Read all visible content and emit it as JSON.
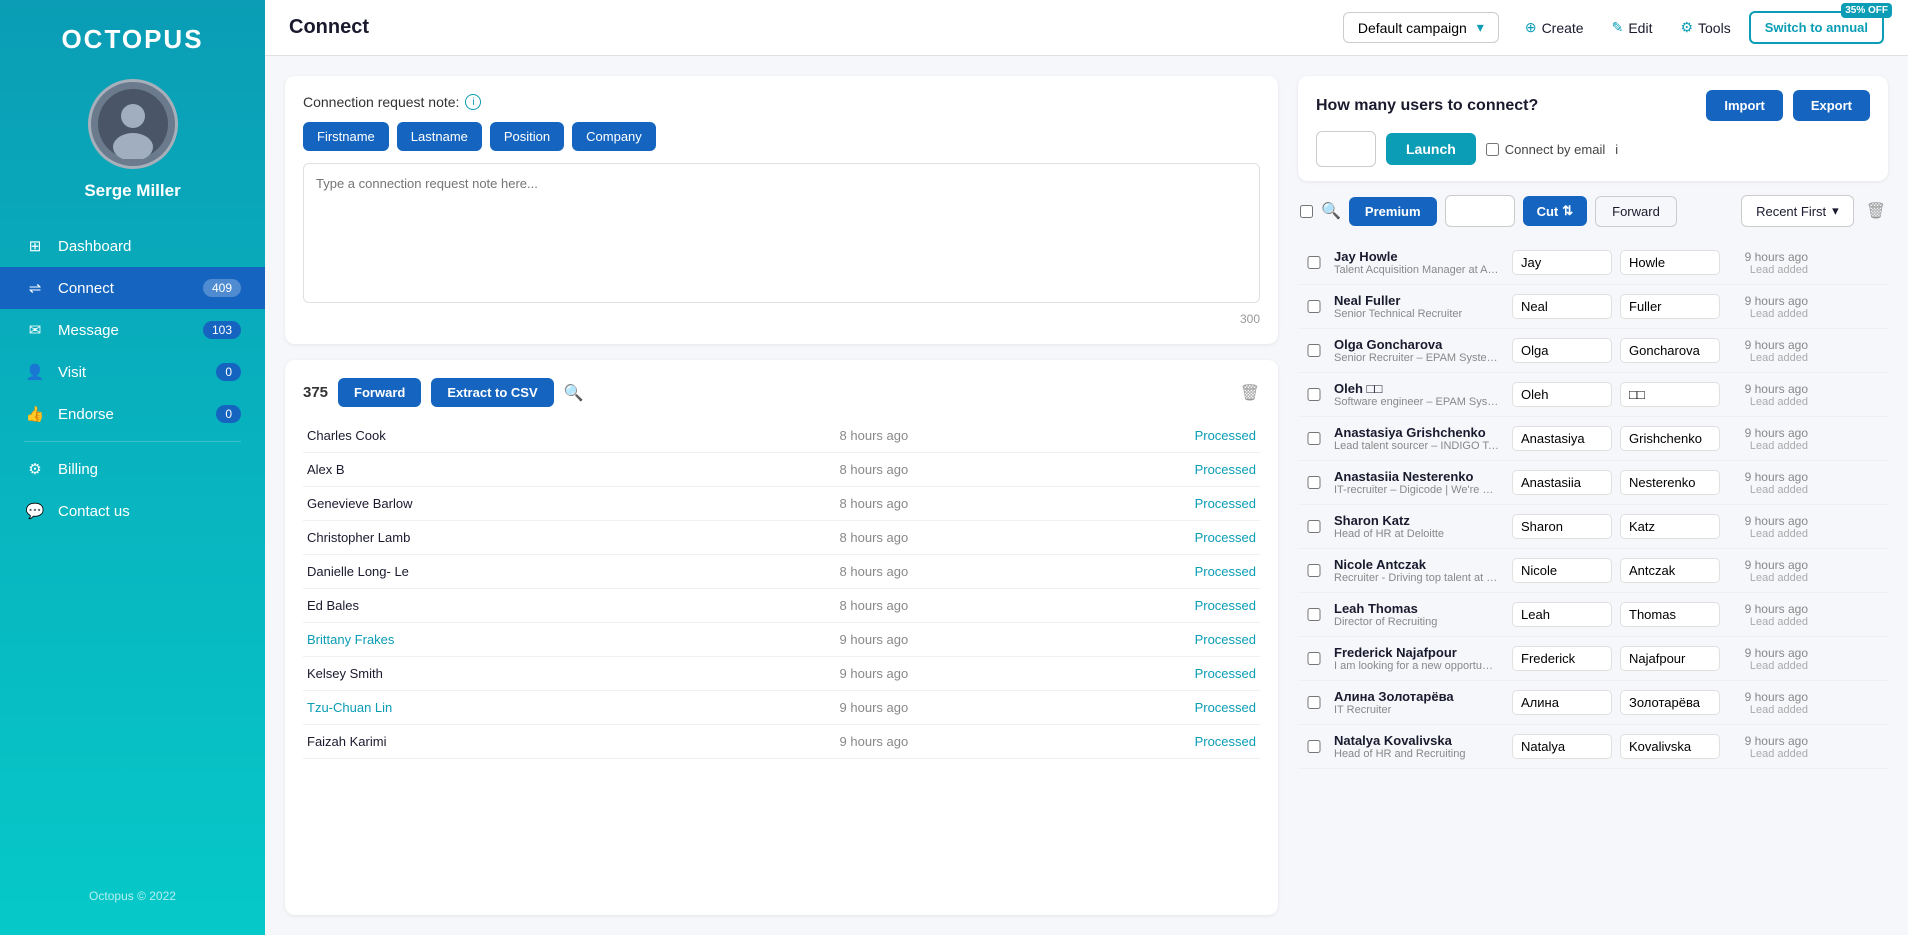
{
  "app": {
    "logo": "OCTOPUS",
    "copyright": "Octopus © 2022"
  },
  "user": {
    "name": "Serge Miller"
  },
  "sidebar": {
    "items": [
      {
        "id": "dashboard",
        "label": "Dashboard",
        "badge": null,
        "icon": "grid"
      },
      {
        "id": "connect",
        "label": "Connect",
        "badge": "409",
        "icon": "link",
        "active": true
      },
      {
        "id": "message",
        "label": "Message",
        "badge": "103",
        "icon": "mail"
      },
      {
        "id": "visit",
        "label": "Visit",
        "badge": "0",
        "icon": "user"
      },
      {
        "id": "endorse",
        "label": "Endorse",
        "badge": "0",
        "icon": "thumbsup"
      },
      {
        "id": "billing",
        "label": "Billing",
        "badge": null,
        "icon": "gear"
      },
      {
        "id": "contact-us",
        "label": "Contact us",
        "badge": null,
        "icon": "chat"
      }
    ]
  },
  "topbar": {
    "title": "Connect",
    "campaign": "Default campaign",
    "create_label": "Create",
    "edit_label": "Edit",
    "tools_label": "Tools",
    "switch_label": "Switch to annual",
    "discount": "35% OFF"
  },
  "connection_note": {
    "label": "Connection request note:",
    "placeholder": "Type a connection request note here...",
    "char_count": "300",
    "tags": [
      "Firstname",
      "Lastname",
      "Position",
      "Company"
    ]
  },
  "list": {
    "count": "375",
    "forward_label": "Forward",
    "csv_label": "Extract to CSV",
    "rows": [
      {
        "name": "Charles Cook",
        "time": "8 hours ago",
        "status": "Processed",
        "link": false
      },
      {
        "name": "Alex B",
        "time": "8 hours ago",
        "status": "Processed",
        "link": false
      },
      {
        "name": "Genevieve Barlow",
        "time": "8 hours ago",
        "status": "Processed",
        "link": false
      },
      {
        "name": "Christopher Lamb",
        "time": "8 hours ago",
        "status": "Processed",
        "link": false
      },
      {
        "name": "Danielle Long- Le",
        "time": "8 hours ago",
        "status": "Processed",
        "link": false
      },
      {
        "name": "Ed Bales",
        "time": "8 hours ago",
        "status": "Processed",
        "link": false
      },
      {
        "name": "Brittany Frakes",
        "time": "9 hours ago",
        "status": "Processed",
        "link": true
      },
      {
        "name": "Kelsey Smith",
        "time": "9 hours ago",
        "status": "Processed",
        "link": false
      },
      {
        "name": "Tzu-Chuan Lin",
        "time": "9 hours ago",
        "status": "Processed",
        "link": true
      },
      {
        "name": "Faizah Karimi",
        "time": "9 hours ago",
        "status": "Processed",
        "link": false
      }
    ]
  },
  "right_panel": {
    "connect_label": "How many users to connect?",
    "count_value": "",
    "launch_label": "Launch",
    "connect_email_label": "Connect by email",
    "import_label": "Import",
    "export_label": "Export",
    "premium_label": "Premium",
    "cut_label": "Cut",
    "forward_label": "Forward",
    "sort_label": "Recent First",
    "contacts": [
      {
        "name": "Jay Howle",
        "title": "Talent Acquisition Manager at AE...",
        "first": "Jay",
        "last": "Howle",
        "time": "9 hours ago",
        "lead": "Lead added"
      },
      {
        "name": "Neal Fuller",
        "title": "Senior Technical Recruiter",
        "first": "Neal",
        "last": "Fuller",
        "time": "9 hours ago",
        "lead": "Lead added"
      },
      {
        "name": "Olga Goncharova",
        "title": "Senior Recruiter – EPAM Systems",
        "first": "Olga",
        "last": "Goncharova",
        "time": "9 hours ago",
        "lead": "Lead added"
      },
      {
        "name": "Oleh □□",
        "title": "Software engineer – EPAM Syste...",
        "first": "Oleh",
        "last": "□□",
        "time": "9 hours ago",
        "lead": "Lead added"
      },
      {
        "name": "Anastasiya Grishchenko",
        "title": "Lead talent sourcer – INDIGO Tec...",
        "first": "Anastasiya",
        "last": "Grishchenko",
        "time": "9 hours ago",
        "lead": "Lead added"
      },
      {
        "name": "Anastasiia Nesterenko",
        "title": "IT-recruiter – Digicode | We're Ukr...",
        "first": "Anastasiia",
        "last": "Nesterenko",
        "time": "9 hours ago",
        "lead": "Lead added"
      },
      {
        "name": "Sharon Katz",
        "title": "Head of HR at Deloitte",
        "first": "Sharon",
        "last": "Katz",
        "time": "9 hours ago",
        "lead": "Lead added"
      },
      {
        "name": "Nicole Antczak",
        "title": "Recruiter - Driving top talent at Ri...",
        "first": "Nicole",
        "last": "Antczak",
        "time": "9 hours ago",
        "lead": "Lead added"
      },
      {
        "name": "Leah Thomas",
        "title": "Director of Recruiting",
        "first": "Leah",
        "last": "Thomas",
        "time": "9 hours ago",
        "lead": "Lead added"
      },
      {
        "name": "Frederick Najafpour",
        "title": "I am looking for a new opportunity.",
        "first": "Frederick",
        "last": "Najafpour",
        "time": "9 hours ago",
        "lead": "Lead added"
      },
      {
        "name": "Алина Золотарёва",
        "title": "IT Recruiter",
        "first": "Алина",
        "last": "Золотарёва",
        "time": "9 hours ago",
        "lead": "Lead added"
      },
      {
        "name": "Natalya Kovalivska",
        "title": "Head of HR and Recruiting",
        "first": "Natalya",
        "last": "Kovalivska",
        "time": "9 hours ago",
        "lead": "Lead added"
      }
    ]
  }
}
